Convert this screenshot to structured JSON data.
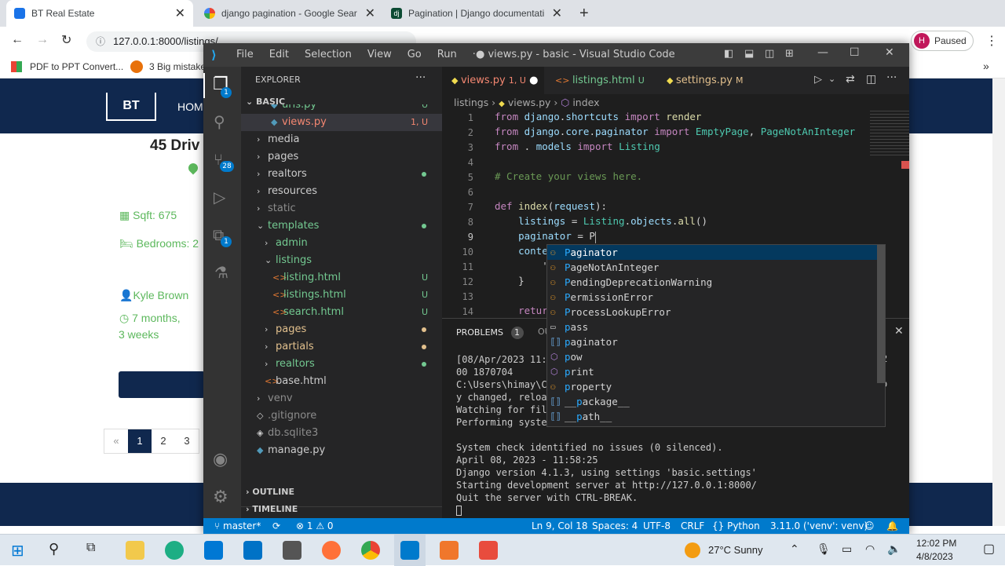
{
  "browser": {
    "tabs": [
      {
        "title": "BT Real Estate"
      },
      {
        "title": "django pagination - Google Sear"
      },
      {
        "title": "Pagination | Django documentati"
      }
    ],
    "new_tab": "+",
    "url": "127.0.0.1:8000/listings/",
    "profile_initial": "H",
    "profile_status": "Paused",
    "bookmarks": [
      "PDF to PPT Convert...",
      "3 Big mistake"
    ],
    "more": "»"
  },
  "site": {
    "nav_home": "HOM",
    "logo_text": "BT",
    "address": "45 Driv",
    "sqft": "Sqft: 675",
    "bedrooms": "Bedrooms: 2",
    "realtor": "Kyle Brown",
    "age1": "7 months,",
    "age2": "3 weeks",
    "pagination": [
      "«",
      "1",
      "2",
      "3"
    ]
  },
  "vscode": {
    "menu": [
      "File",
      "Edit",
      "Selection",
      "View",
      "Go",
      "Run",
      "···"
    ],
    "title": "● views.py - basic - Visual Studio Code",
    "explorer_label": "EXPLORER",
    "project": "BASIC",
    "source_control_badge": "28",
    "explorer_badge": "1",
    "extensions_badge": "1",
    "tree": [
      {
        "name": "urls.py",
        "badge": "U"
      },
      {
        "name": "views.py",
        "badge": "1, U"
      },
      {
        "name": "media",
        "badge": ""
      },
      {
        "name": "pages",
        "badge": ""
      },
      {
        "name": "realtors",
        "badge": ""
      },
      {
        "name": "resources",
        "badge": ""
      },
      {
        "name": "static",
        "badge": ""
      },
      {
        "name": "templates",
        "badge": ""
      },
      {
        "name": "admin",
        "badge": ""
      },
      {
        "name": "listings",
        "badge": ""
      },
      {
        "name": "listing.html",
        "badge": "U"
      },
      {
        "name": "listings.html",
        "badge": "U"
      },
      {
        "name": "search.html",
        "badge": "U"
      },
      {
        "name": "pages",
        "badge": ""
      },
      {
        "name": "partials",
        "badge": ""
      },
      {
        "name": "realtors",
        "badge": ""
      },
      {
        "name": "base.html",
        "badge": ""
      },
      {
        "name": "venv",
        "badge": ""
      },
      {
        "name": ".gitignore",
        "badge": ""
      },
      {
        "name": "db.sqlite3",
        "badge": ""
      },
      {
        "name": "manage.py",
        "badge": ""
      }
    ],
    "outline": "OUTLINE",
    "timeline": "TIMELINE",
    "tabs": [
      {
        "name": "views.py",
        "badge": "1, U"
      },
      {
        "name": "listings.html",
        "badge": "U"
      },
      {
        "name": "settings.py",
        "badge": "M"
      }
    ],
    "breadcrumb": [
      "listings",
      "views.py",
      "index"
    ],
    "code_lines": [
      "from django.shortcuts import render",
      "from django.core.paginator import EmptyPage, PageNotAnInteger",
      "from . models import Listing",
      "",
      "# Create your views here.",
      "",
      "def index(request):",
      "    listings = Listing.objects.all()",
      "    paginator = P",
      "    conte",
      "        '",
      "    }",
      "",
      "    retur"
    ],
    "suggestions": [
      {
        "icon": "class",
        "text": "Paginator"
      },
      {
        "icon": "class",
        "text": "PageNotAnInteger"
      },
      {
        "icon": "class",
        "text": "PendingDeprecationWarning"
      },
      {
        "icon": "class",
        "text": "PermissionError"
      },
      {
        "icon": "class",
        "text": "ProcessLookupError"
      },
      {
        "icon": "keyword",
        "text": "pass"
      },
      {
        "icon": "variable",
        "text": "paginator"
      },
      {
        "icon": "function",
        "text": "pow"
      },
      {
        "icon": "function",
        "text": "print"
      },
      {
        "icon": "class",
        "text": "property"
      },
      {
        "icon": "variable",
        "text": "__package__"
      },
      {
        "icon": "variable",
        "text": "__path__"
      }
    ],
    "panel_tab": "PROBLEMS",
    "panel_count": "1",
    "panel_tab2": "OU",
    "terminal": [
      "[08/Apr/2023 11:",
      "00 1870704",
      "C:\\Users\\himay\\C",
      "y changed, reloa",
      "Watching for fil",
      "Performing syste",
      "",
      "System check identified no issues (0 silenced).",
      "April 08, 2023 - 11:58:25",
      "Django version 4.1.3, using settings 'basic.settings'",
      "Starting development server at http://127.0.0.1:8000/",
      "Quit the server with CTRL-BREAK."
    ],
    "terminal_right": [
      "2",
      "o"
    ],
    "status": {
      "branch": "master*",
      "problems": "⊗ 1 ⚠ 0",
      "position": "Ln 9, Col 18",
      "spaces": "Spaces: 4",
      "encoding": "UTF-8",
      "eol": "CRLF",
      "language": "Python",
      "interpreter": "3.11.0 ('venv': venv)"
    }
  },
  "taskbar": {
    "weather": "27°C  Sunny",
    "time": "12:02 PM",
    "date": "4/8/2023"
  }
}
